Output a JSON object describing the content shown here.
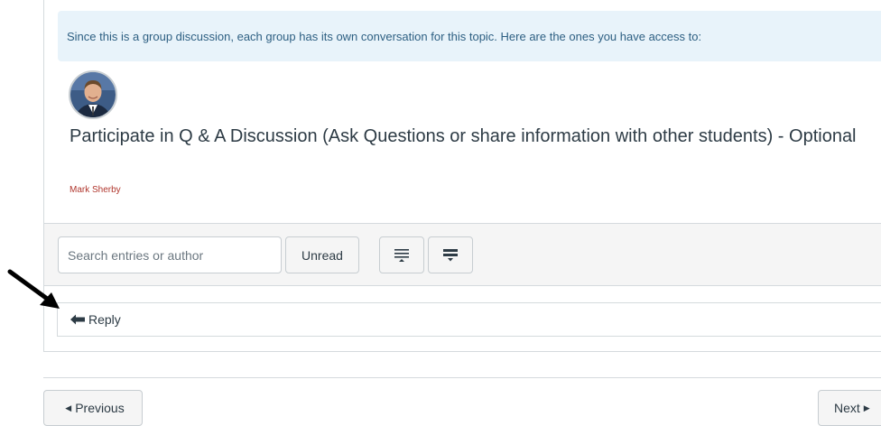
{
  "banner": {
    "text": "Since this is a group discussion, each group has its own conversation for this topic. Here are the ones you have access to:"
  },
  "topic": {
    "title": "Participate in Q & A Discussion (Ask Questions or share information with other students) - Optional",
    "author": "Mark Sherby"
  },
  "toolbar": {
    "search_placeholder": "Search entries or author",
    "unread_label": "Unread",
    "collapse_icon": "collapse-replies-icon",
    "expand_icon": "expand-replies-icon"
  },
  "reply": {
    "label": "Reply",
    "icon": "reply-arrow-icon"
  },
  "pagination": {
    "previous_label": "Previous",
    "next_label": "Next"
  },
  "colors": {
    "banner_bg": "#e8f3fa",
    "author": "#b0362d",
    "toolbar_bg": "#f5f5f5"
  }
}
